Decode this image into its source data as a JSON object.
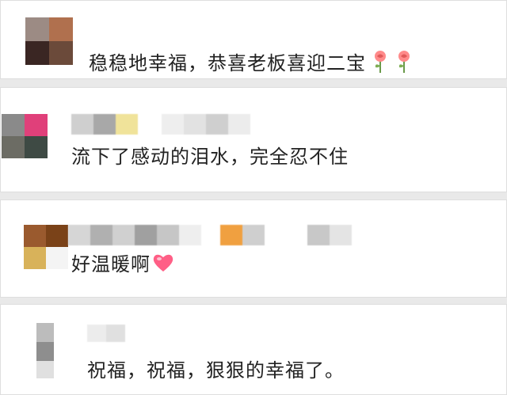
{
  "comments": [
    {
      "text": "稳稳地幸福，恭喜老板喜迎二宝",
      "emoji": [
        "rose-icon",
        "rose-icon"
      ]
    },
    {
      "text": "流下了感动的泪水，完全忍不住",
      "emoji": []
    },
    {
      "text": "好温暖啊",
      "emoji": [
        "heart-icon"
      ]
    },
    {
      "text": "祝福，祝福，狠狠的幸福了。",
      "emoji": []
    }
  ],
  "colors": {
    "background": "#e9e9e9",
    "card": "#ffffff",
    "text": "#222222",
    "heart": "#ff5f86",
    "rose": "#ff8a8a"
  }
}
